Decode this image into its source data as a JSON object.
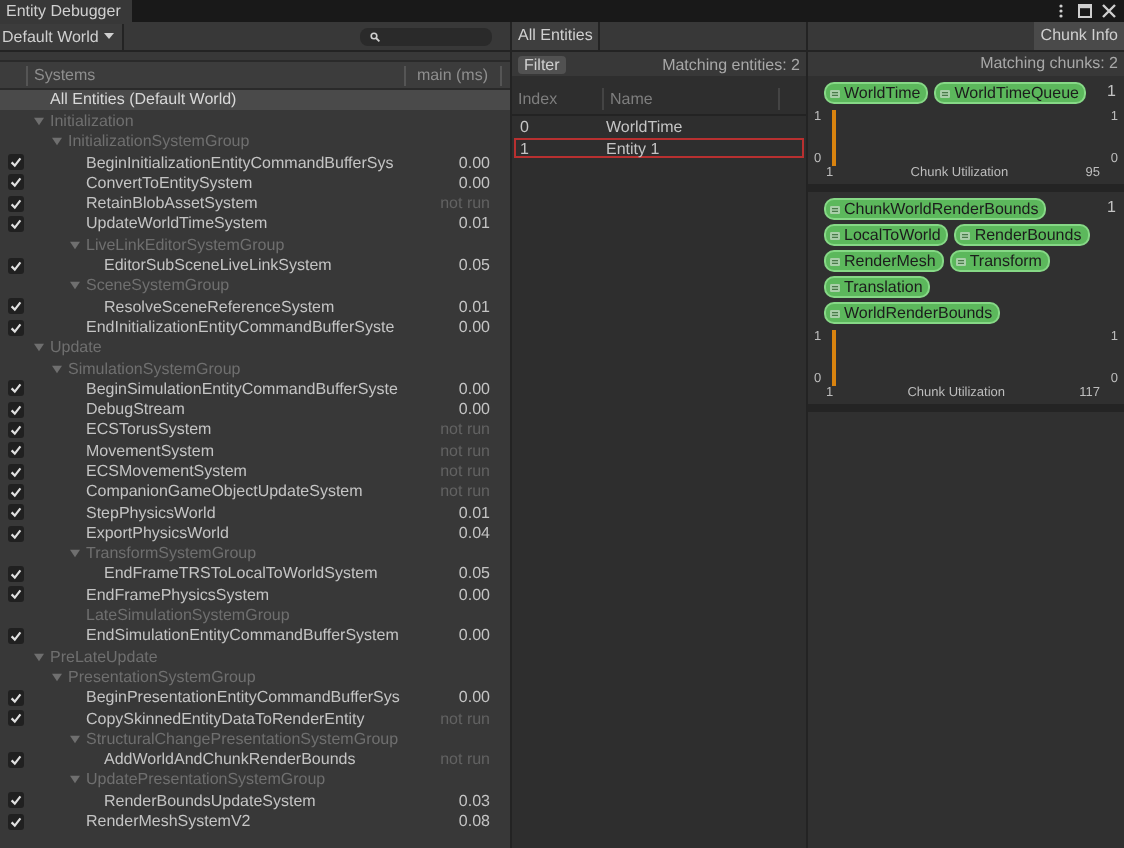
{
  "window": {
    "title": "Entity Debugger"
  },
  "toolbar": {
    "world_dropdown": "Default World"
  },
  "systems": {
    "columns": [
      "Systems",
      "main (ms)"
    ],
    "all_entities": {
      "label": "All Entities (Default World)",
      "selected": true
    },
    "tree": [
      {
        "kind": "group",
        "label": "Initialization",
        "expanded": true,
        "children": [
          {
            "kind": "group",
            "label": "InitializationSystemGroup",
            "expanded": true,
            "children": [
              {
                "kind": "system",
                "label": "BeginInitializationEntityCommandBufferSys",
                "enabled": true,
                "time": "0.00"
              },
              {
                "kind": "system",
                "label": "ConvertToEntitySystem",
                "enabled": true,
                "time": "0.00"
              },
              {
                "kind": "system",
                "label": "RetainBlobAssetSystem",
                "enabled": true,
                "time": "not run"
              },
              {
                "kind": "system",
                "label": "UpdateWorldTimeSystem",
                "enabled": true,
                "time": "0.01"
              },
              {
                "kind": "group",
                "label": "LiveLinkEditorSystemGroup",
                "expanded": true,
                "children": [
                  {
                    "kind": "system",
                    "label": "EditorSubSceneLiveLinkSystem",
                    "enabled": true,
                    "time": "0.05"
                  }
                ]
              },
              {
                "kind": "group",
                "label": "SceneSystemGroup",
                "expanded": true,
                "children": [
                  {
                    "kind": "system",
                    "label": "ResolveSceneReferenceSystem",
                    "enabled": true,
                    "time": "0.01"
                  }
                ]
              },
              {
                "kind": "system",
                "label": "EndInitializationEntityCommandBufferSyste",
                "enabled": true,
                "time": "0.00"
              }
            ]
          }
        ]
      },
      {
        "kind": "group",
        "label": "Update",
        "expanded": true,
        "children": [
          {
            "kind": "group",
            "label": "SimulationSystemGroup",
            "expanded": true,
            "children": [
              {
                "kind": "system",
                "label": "BeginSimulationEntityCommandBufferSyste",
                "enabled": true,
                "time": "0.00"
              },
              {
                "kind": "system",
                "label": "DebugStream",
                "enabled": true,
                "time": "0.00"
              },
              {
                "kind": "system",
                "label": "ECSTorusSystem",
                "enabled": true,
                "time": "not run"
              },
              {
                "kind": "system",
                "label": "MovementSystem",
                "enabled": true,
                "time": "not run"
              },
              {
                "kind": "system",
                "label": "ECSMovementSystem",
                "enabled": true,
                "time": "not run"
              },
              {
                "kind": "system",
                "label": "CompanionGameObjectUpdateSystem",
                "enabled": true,
                "time": "not run"
              },
              {
                "kind": "system",
                "label": "StepPhysicsWorld",
                "enabled": true,
                "time": "0.01"
              },
              {
                "kind": "system",
                "label": "ExportPhysicsWorld",
                "enabled": true,
                "time": "0.04"
              },
              {
                "kind": "group",
                "label": "TransformSystemGroup",
                "expanded": true,
                "children": [
                  {
                    "kind": "system",
                    "label": "EndFrameTRSToLocalToWorldSystem",
                    "enabled": true,
                    "time": "0.05"
                  }
                ]
              },
              {
                "kind": "system",
                "label": "EndFramePhysicsSystem",
                "enabled": true,
                "time": "0.00"
              },
              {
                "kind": "group",
                "label": "LateSimulationSystemGroup"
              },
              {
                "kind": "system",
                "label": "EndSimulationEntityCommandBufferSystem",
                "enabled": true,
                "time": "0.00"
              }
            ]
          }
        ]
      },
      {
        "kind": "group",
        "label": "PreLateUpdate",
        "expanded": true,
        "children": [
          {
            "kind": "group",
            "label": "PresentationSystemGroup",
            "expanded": true,
            "children": [
              {
                "kind": "system",
                "label": "BeginPresentationEntityCommandBufferSys",
                "enabled": true,
                "time": "0.00"
              },
              {
                "kind": "system",
                "label": "CopySkinnedEntityDataToRenderEntity",
                "enabled": true,
                "time": "not run"
              },
              {
                "kind": "group",
                "label": "StructuralChangePresentationSystemGroup",
                "expanded": true,
                "children": [
                  {
                    "kind": "system",
                    "label": "AddWorldAndChunkRenderBounds",
                    "enabled": true,
                    "time": "not run"
                  }
                ]
              },
              {
                "kind": "group",
                "label": "UpdatePresentationSystemGroup",
                "expanded": true,
                "children": [
                  {
                    "kind": "system",
                    "label": "RenderBoundsUpdateSystem",
                    "enabled": true,
                    "time": "0.03"
                  }
                ]
              },
              {
                "kind": "system",
                "label": "RenderMeshSystemV2",
                "enabled": true,
                "time": "0.08"
              }
            ]
          }
        ]
      }
    ]
  },
  "entities": {
    "title": "All Entities",
    "filter_button": "Filter",
    "matching": "Matching entities: 2",
    "columns": [
      "Index",
      "Name"
    ],
    "rows": [
      {
        "index": "0",
        "name": "WorldTime",
        "selected": false
      },
      {
        "index": "1",
        "name": "Entity 1",
        "selected": true
      }
    ]
  },
  "chunks": {
    "chunk_info_button": "Chunk Info",
    "matching": "Matching chunks: 2",
    "archetypes": [
      {
        "components": [
          "WorldTime",
          "WorldTimeQueue"
        ],
        "chunk_count": "1",
        "utilization": {
          "left_labels": [
            "1",
            "0"
          ],
          "right_labels": [
            "1",
            "0"
          ],
          "x_min": "1",
          "x_title": "Chunk Utilization",
          "x_max": "95"
        }
      },
      {
        "components": [
          "ChunkWorldRenderBounds",
          "LocalToWorld",
          "RenderBounds",
          "RenderMesh",
          "Transform",
          "Translation",
          "WorldRenderBounds"
        ],
        "chunk_count": "1",
        "utilization": {
          "left_labels": [
            "1",
            "0"
          ],
          "right_labels": [
            "1",
            "0"
          ],
          "x_min": "1",
          "x_title": "Chunk Utilization",
          "x_max": "117"
        }
      }
    ]
  }
}
